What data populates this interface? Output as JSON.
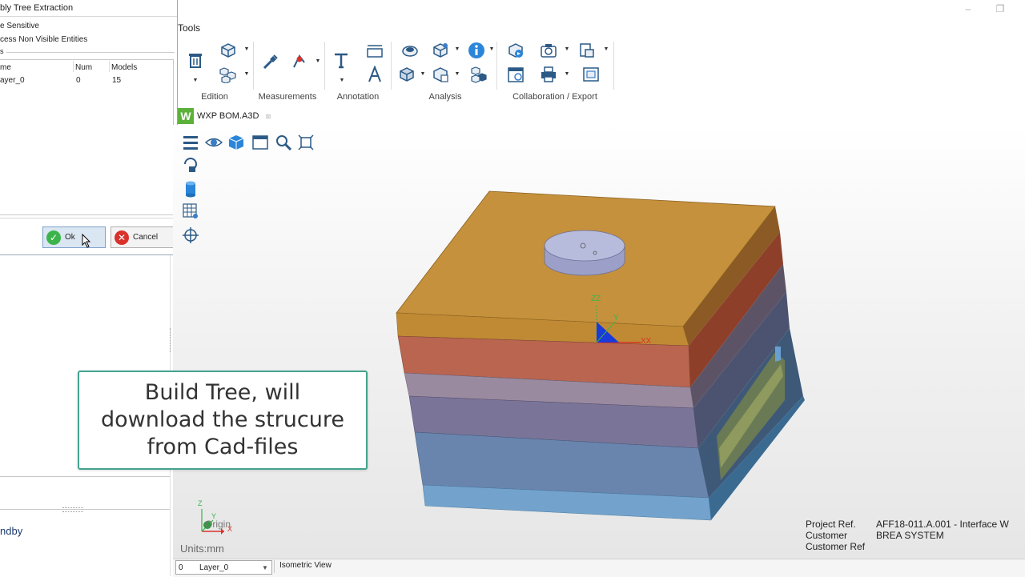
{
  "window": {
    "minimize_icon": "minimize-icon",
    "restore_icon": "restore-icon"
  },
  "menu": {
    "tools_label": "Tools"
  },
  "ribbon": {
    "groups": [
      {
        "label": "Edition"
      },
      {
        "label": "Measurements"
      },
      {
        "label": "Annotation"
      },
      {
        "label": "Analysis"
      },
      {
        "label": "Collaboration / Export"
      }
    ]
  },
  "document": {
    "tab_label": "WXP BOM.A3D",
    "close_glyph": "⊠"
  },
  "dialog": {
    "title": "bly Tree Extraction",
    "option1": "e Sensitive",
    "option2": "cess Non Visible Entities",
    "section_label": "s",
    "columns": [
      "me",
      "Num",
      "Models"
    ],
    "rows": [
      {
        "name": "ayer_0",
        "num": "0",
        "models": "15"
      }
    ],
    "ok_label": "Ok",
    "cancel_label": "Cancel"
  },
  "left_panel": {
    "status_text": "ndby"
  },
  "callout": {
    "text": "Build Tree, will\ndownload the strucure\nfrom Cad-files"
  },
  "viewport": {
    "axis_x": "X",
    "axis_y": "Y",
    "axis_z": "Z",
    "origin_label": "Origin",
    "units": "Units:mm",
    "project_ref_label": "Project Ref.",
    "project_ref_value": "AFF18-011.A.001 - Interface W",
    "customer_label": "Customer",
    "customer_value": "BREA SYSTEM",
    "customer_ref_label": "Customer Ref",
    "model_axis_x": "XX",
    "model_axis_y": "Y",
    "model_axis_z": "ZZ"
  },
  "statusbar": {
    "layer_num": "0",
    "layer_name": "Layer_0",
    "view_name": "Isometric View"
  },
  "colors": {
    "accent_green": "#43a48d",
    "ok_green": "#3cb44b",
    "cancel_red": "#d9322b"
  }
}
